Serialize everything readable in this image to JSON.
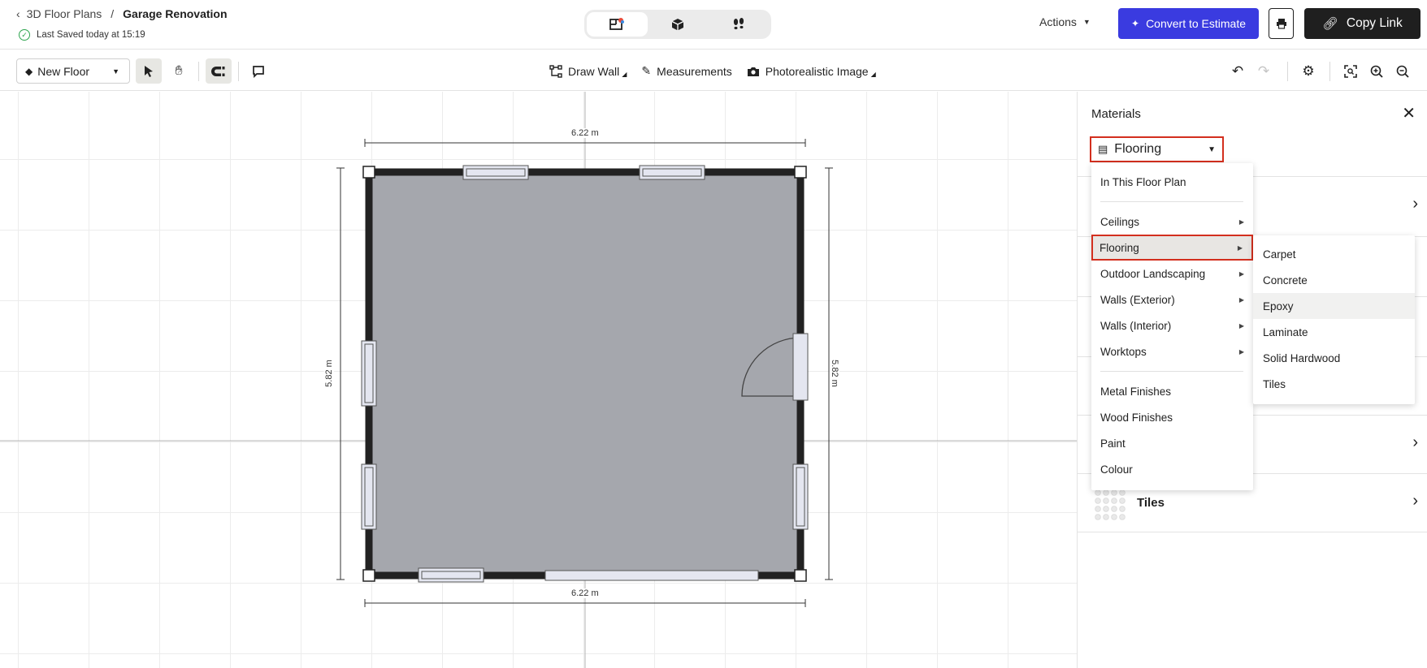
{
  "header": {
    "back_icon": "chevron-left-icon",
    "breadcrumb_parent": "3D Floor Plans",
    "breadcrumb_sep": "/",
    "breadcrumb_current": "Garage Renovation",
    "saved_status": "Last Saved today at 15:19",
    "view_modes": [
      "2d-plan-icon",
      "3d-box-icon",
      "walkthrough-footsteps-icon"
    ],
    "actions_label": "Actions",
    "convert_label": "Convert to Estimate",
    "copy_link_label": "Copy Link",
    "accent_color": "#3a3be0"
  },
  "toolbar": {
    "floor_label": "New Floor",
    "draw_wall_label": "Draw Wall",
    "measurements_label": "Measurements",
    "photo_label": "Photorealistic Image"
  },
  "canvas": {
    "top_dim": "6.22 m",
    "bottom_dim": "6.22 m",
    "left_dim": "5.82 m",
    "right_dim": "5.82 m",
    "room_fill": "#a5a7ad"
  },
  "panel": {
    "title": "Materials",
    "selected_category": "Flooring",
    "rows": [
      {
        "name": ""
      },
      {
        "name": ""
      },
      {
        "name": ""
      },
      {
        "name": ""
      },
      {
        "name": "Tiles"
      }
    ]
  },
  "menu": {
    "top_item": "In This Floor Plan",
    "group1": [
      "Ceilings",
      "Flooring",
      "Outdoor Landscaping",
      "Walls (Exterior)",
      "Walls (Interior)",
      "Worktops"
    ],
    "group2": [
      "Metal Finishes",
      "Wood Finishes",
      "Paint",
      "Colour"
    ],
    "highlighted": "Flooring",
    "highlight_color": "#d32f1e"
  },
  "submenu": {
    "items": [
      "Carpet",
      "Concrete",
      "Epoxy",
      "Laminate",
      "Solid Hardwood",
      "Tiles"
    ],
    "hovered": "Epoxy"
  }
}
